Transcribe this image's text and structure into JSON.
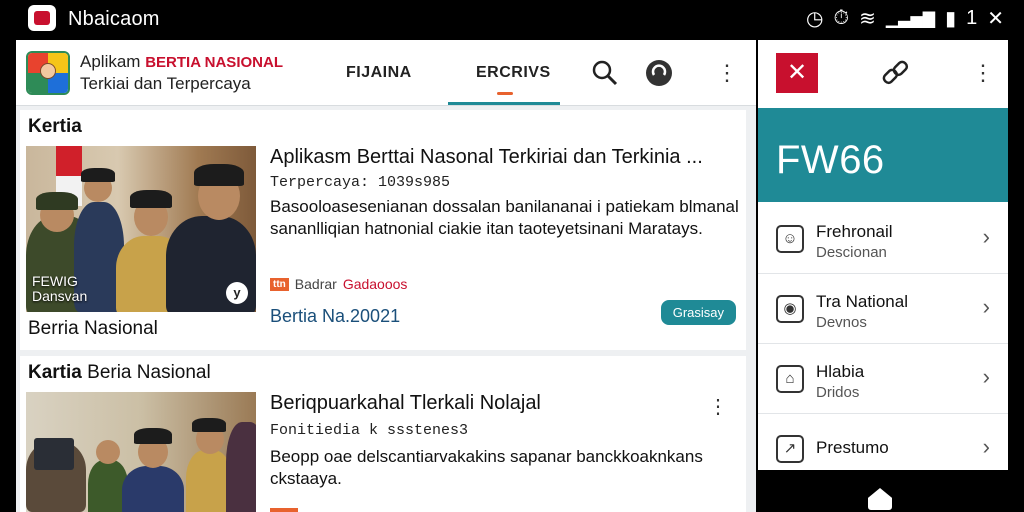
{
  "status_bar": {
    "title": "Nbaicaom",
    "icons": [
      "alarm-icon",
      "timer-icon",
      "wifi-icon",
      "signal-icon",
      "battery-icon"
    ],
    "badge": "1"
  },
  "app": {
    "brand_line1_a": "Aplikam",
    "brand_line1_b": "BERTIA NASIONAL",
    "brand_line2": "Terkiai dan Terpercaya",
    "tabs": [
      "FIJAINA",
      "ERCRIVS"
    ],
    "accent_color": "#1f8a96",
    "brand_red": "#c8102e"
  },
  "card1": {
    "header": "Kertia",
    "thumb_caption_1": "FEWIG",
    "thumb_caption_2": "Dansvan",
    "thumb_badge": "y",
    "under_thumb": "Berria Nasional",
    "title": "Aplikasm Berttai Nasonal Terkiriai dan Terkinia ...",
    "subtitle": "Terpercaya: 1039s985",
    "body": "Basooloasesenianan dossalan banilananai i patiekam blmanal sananlliqian hatnonial ciakie itan taoteyetsinani Maratays.",
    "meta_tag": "ttn",
    "meta_source": "Badrar",
    "meta_code": "Gadaooos",
    "date": "Bertia Na.20021",
    "pill": "Grasisay"
  },
  "card2": {
    "header_bold": "Kartia",
    "header_rest": "Beria Nasional",
    "title": "Beriq​puarkahal Tlerkali Nolajal",
    "subtitle": "Fon​itiedia k ssstenes3",
    "body": "Beopp oae delscantiarvakakins sapanar banckkoaknkans ckstaaya."
  },
  "side": {
    "hero": "FW66",
    "items": [
      {
        "title": "Frehronail",
        "subtitle": "Descionan",
        "icon": "person-icon"
      },
      {
        "title": "Tra National",
        "subtitle": "Devnos",
        "icon": "news-icon"
      },
      {
        "title": "Hlabia",
        "subtitle": "Dridos",
        "icon": "home-icon"
      },
      {
        "title": "Prestumo",
        "subtitle": "",
        "icon": "chart-icon"
      }
    ]
  }
}
